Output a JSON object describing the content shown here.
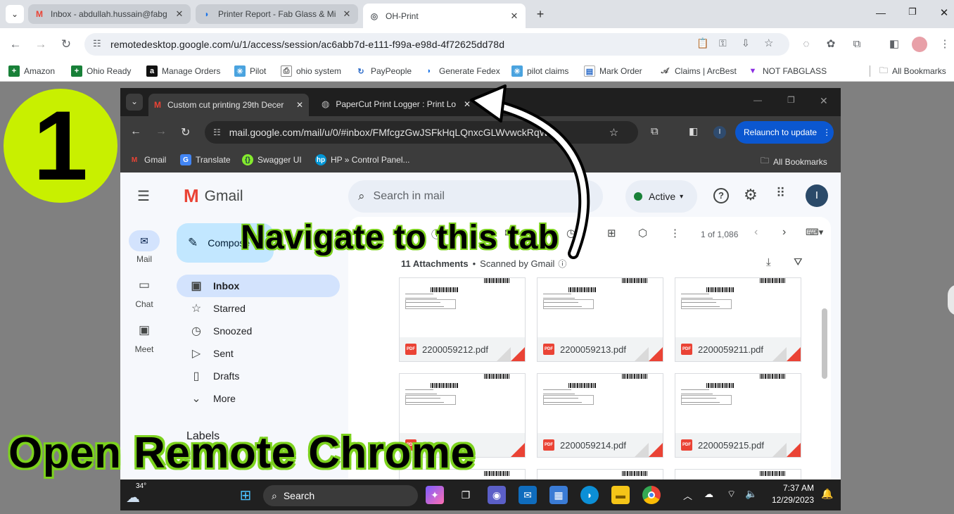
{
  "outer_browser": {
    "tabs": [
      {
        "title": "Inbox - abdullah.hussain@fabg",
        "icon": "gmail-icon"
      },
      {
        "title": "Printer Report - Fab Glass & Mi",
        "icon": "edge-icon"
      },
      {
        "title": "OH-Print",
        "icon": "remote-desktop-icon"
      }
    ],
    "url": "remotedesktop.google.com/u/1/access/session/ac6abb7d-e111-f99a-e98d-4f72625dd78d",
    "bookmarks": [
      "Amazon",
      "Ohio Ready",
      "Manage Orders",
      "Pilot",
      "ohio system",
      "PayPeople",
      "Generate Fedex",
      "pilot claims",
      "Mark Order",
      "Claims | ArcBest",
      "NOT FABGLASS"
    ],
    "all_bookmarks": "All Bookmarks"
  },
  "inner_browser": {
    "tabs": [
      {
        "title": "Custom cut printing 29th Decer",
        "icon": "gmail-icon"
      },
      {
        "title": "PaperCut Print Logger : Print Lo",
        "icon": "globe-icon"
      }
    ],
    "url": "mail.google.com/mail/u/0/#inbox/FMfcgzGwJSFkHqLQnxcGLWvwckRqW...",
    "profile_initial": "I",
    "relaunch_label": "Relaunch to update",
    "bookmarks": [
      "Gmail",
      "Translate",
      "Swagger UI",
      "HP » Control Panel..."
    ],
    "all_bookmarks": "All Bookmarks"
  },
  "gmail": {
    "logo_text": "Gmail",
    "search_placeholder": "Search in mail",
    "status": "Active",
    "avatar_initial": "I",
    "compose_label": "Compose",
    "rail": [
      {
        "label": "Mail",
        "icon": "mail-icon"
      },
      {
        "label": "Chat",
        "icon": "chat-icon"
      },
      {
        "label": "Meet",
        "icon": "video-icon"
      }
    ],
    "nav": [
      {
        "label": "Inbox",
        "icon": "inbox-icon"
      },
      {
        "label": "Starred",
        "icon": "star-icon"
      },
      {
        "label": "Snoozed",
        "icon": "clock-icon"
      },
      {
        "label": "Sent",
        "icon": "send-icon"
      },
      {
        "label": "Drafts",
        "icon": "draft-icon"
      },
      {
        "label": "More",
        "icon": "chevron-down-icon"
      }
    ],
    "labels_heading": "Labels",
    "pagination": "1 of 1,086",
    "attachments_heading": "11 Attachments",
    "scanned_label": "Scanned by Gmail",
    "attachments": [
      "2200059212.pdf",
      "2200059213.pdf",
      "2200059211.pdf",
      "2200059214.pdf",
      "2200059215.pdf"
    ],
    "pdf_badge": "PDF"
  },
  "taskbar": {
    "weather": "34°",
    "search_label": "Search",
    "time": "7:37 AM",
    "date": "12/29/2023"
  },
  "overlay": {
    "step_number": "1",
    "navigate_text": "Navigate to this tab",
    "open_text": "Open Remote Chrome",
    "colors": {
      "step_circle": "#c8f000",
      "outline": "#7dd21f"
    }
  }
}
